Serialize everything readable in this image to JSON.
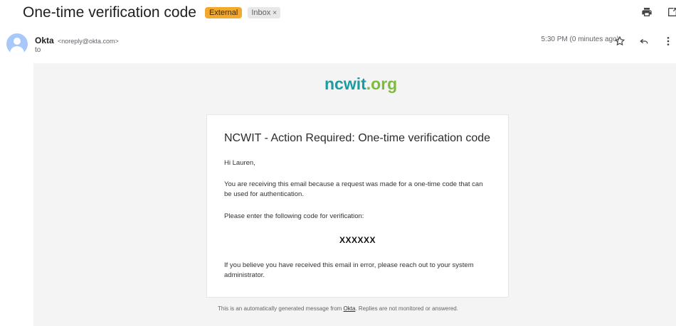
{
  "header": {
    "subject": "One-time verification code",
    "badge_external": "External",
    "badge_inbox": "Inbox",
    "badge_close": "×"
  },
  "sender": {
    "name": "Okta",
    "email": "<noreply@okta.com>",
    "to": "to",
    "timestamp": "5:30 PM (0 minutes ago)"
  },
  "email": {
    "logo_part1": "ncwit",
    "logo_part2": ".org",
    "title": "NCWIT - Action Required: One-time verification code",
    "greeting": "Hi Lauren,",
    "para1": "You are receiving this email because a request was made for a one-time code that can be used for authentication.",
    "para2": "Please enter the following code for verification:",
    "code": "XXXXXX",
    "para3": "If you believe you have received this email in error, please reach out to your system administrator."
  },
  "footer": {
    "text_before": "This is an automatically generated message from ",
    "link": "Okta",
    "text_after": ". Replies are not monitored or answered."
  },
  "icons": [
    "print-icon",
    "open-new-window-icon",
    "star-icon",
    "reply-icon",
    "more-vert-icon",
    "avatar"
  ],
  "colors": {
    "external_badge": "#f3a92f",
    "logo_primary": "#1c9ba2",
    "logo_secondary": "#7dbb3a",
    "email_background": "#f4f4f4"
  }
}
